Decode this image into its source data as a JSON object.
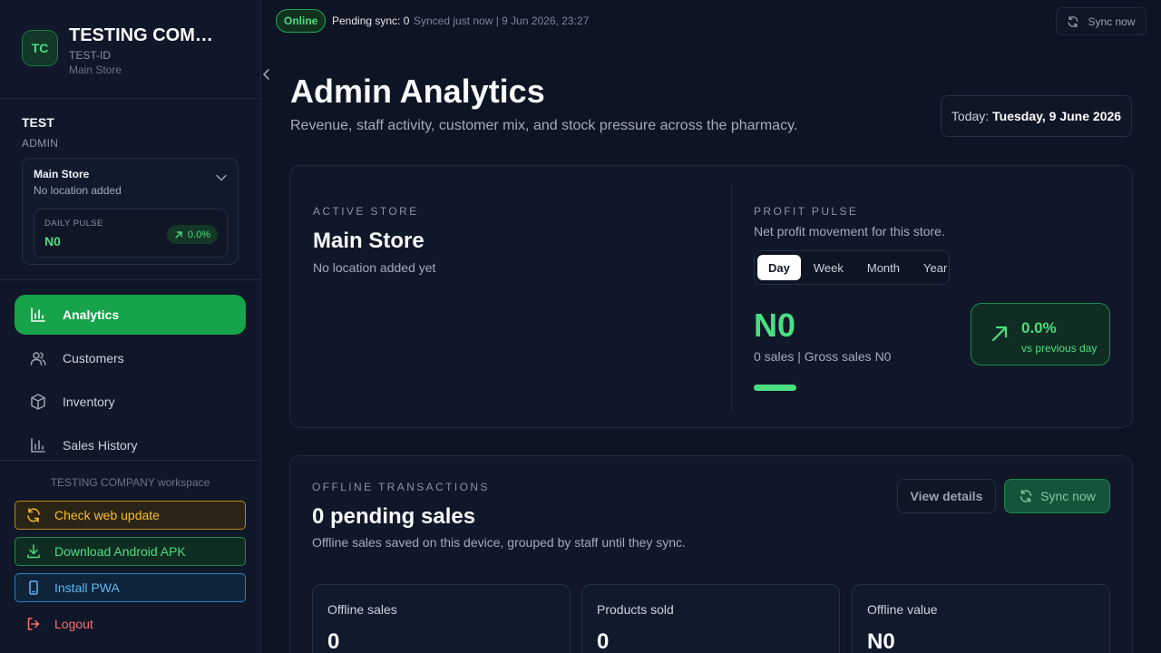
{
  "brand": {
    "initials": "TC",
    "name": "TESTING COMPANY",
    "id": "TEST-ID",
    "store": "Main Store"
  },
  "user": {
    "name": "TEST",
    "role": "ADMIN"
  },
  "store_card": {
    "name": "Main Store",
    "location": "No location added",
    "pulse_label": "DAILY PULSE",
    "pulse_value": "N0",
    "pulse_change": "0.0%"
  },
  "nav": [
    {
      "label": "Analytics",
      "icon": "chart-bar-icon",
      "active": true
    },
    {
      "label": "Customers",
      "icon": "users-icon",
      "active": false
    },
    {
      "label": "Inventory",
      "icon": "box-icon",
      "active": false
    },
    {
      "label": "Sales History",
      "icon": "chart-bar-icon",
      "active": false
    }
  ],
  "workspace": "TESTING COMPANY workspace",
  "side_actions": {
    "check_update": "Check web update",
    "download_apk": "Download Android APK",
    "install_pwa": "Install PWA",
    "logout": "Logout"
  },
  "topbar": {
    "status": "Online",
    "pending": "Pending sync: 0",
    "synced": "Synced just now | 9 Jun 2026, 23:27",
    "sync_label": "Sync now"
  },
  "page": {
    "title": "Admin Analytics",
    "subtitle": "Revenue, staff activity, customer mix, and stock pressure across the pharmacy.",
    "today_prefix": "Today:",
    "today_date": "Tuesday, 9 June 2026"
  },
  "active_store": {
    "eyebrow": "ACTIVE STORE",
    "name": "Main Store",
    "location": "No location added yet"
  },
  "profit_pulse": {
    "eyebrow": "PROFIT PULSE",
    "description": "Net profit movement for this store.",
    "periods": [
      "Day",
      "Week",
      "Month",
      "Year"
    ],
    "selected_period": "Day",
    "value": "N0",
    "summary": "0 sales | Gross sales N0",
    "change": "0.0%",
    "change_note": "vs previous day"
  },
  "offline": {
    "eyebrow": "OFFLINE TRANSACTIONS",
    "title": "0 pending sales",
    "description": "Offline sales saved on this device, grouped by staff until they sync.",
    "view_details": "View details",
    "sync_now": "Sync now",
    "stats": [
      {
        "label": "Offline sales",
        "value": "0"
      },
      {
        "label": "Products sold",
        "value": "0"
      },
      {
        "label": "Offline value",
        "value": "N0"
      }
    ]
  },
  "colors": {
    "accent": "#16a34a",
    "positive": "#4ade80",
    "warning": "#fbbf24",
    "info": "#60b6f5",
    "danger": "#f87171",
    "background": "#0d1424"
  }
}
